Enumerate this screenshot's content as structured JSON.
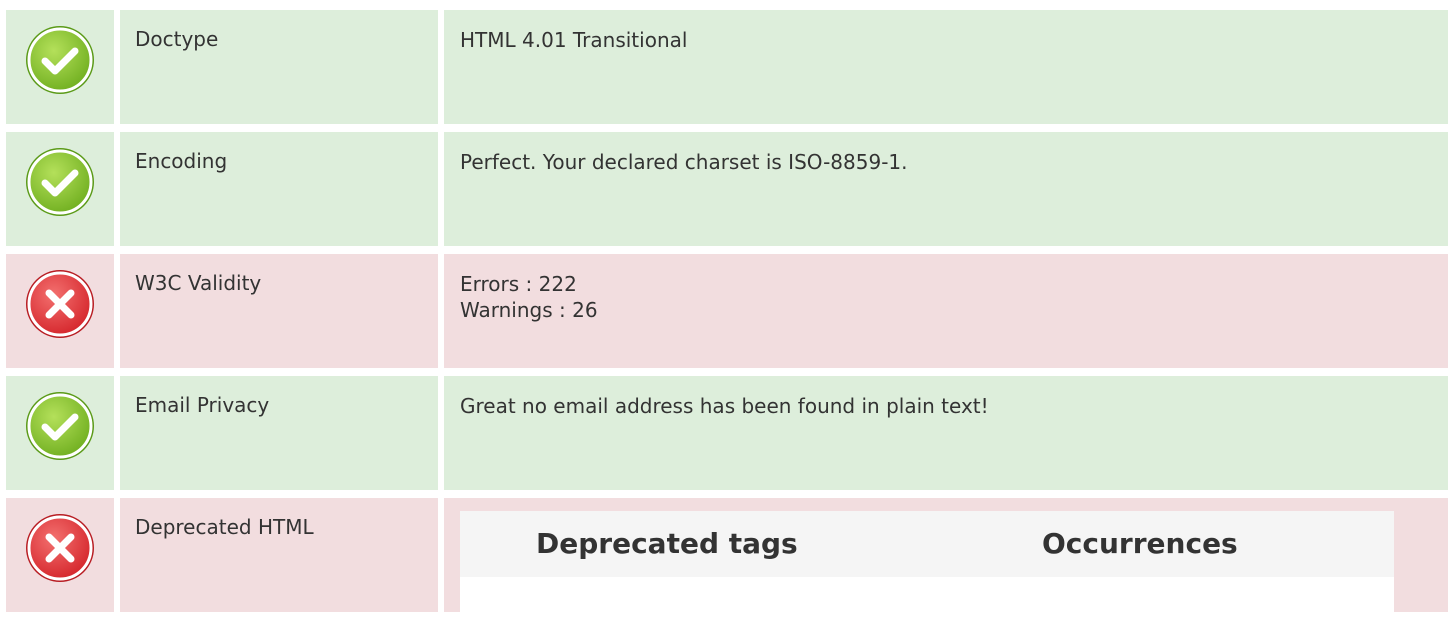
{
  "colors": {
    "pass_bg": "#ddeedb",
    "fail_bg": "#f2dddf",
    "pass_icon": "#8dc63f",
    "fail_icon": "#e5343a"
  },
  "rows": [
    {
      "status": "pass",
      "icon": "check-icon",
      "label": "Doctype",
      "value": "HTML 4.01 Transitional"
    },
    {
      "status": "pass",
      "icon": "check-icon",
      "label": "Encoding",
      "value": "Perfect. Your declared charset is ISO-8859-1."
    },
    {
      "status": "fail",
      "icon": "cross-icon",
      "label": "W3C Validity",
      "errors": "Errors : 222",
      "warnings": "Warnings : 26"
    },
    {
      "status": "pass",
      "icon": "check-icon",
      "label": "Email Privacy",
      "value": "Great no email address has been found in plain text!"
    },
    {
      "status": "fail",
      "icon": "cross-icon",
      "label": "Deprecated HTML",
      "table": {
        "col1": "Deprecated tags",
        "col2": "Occurrences"
      }
    }
  ]
}
